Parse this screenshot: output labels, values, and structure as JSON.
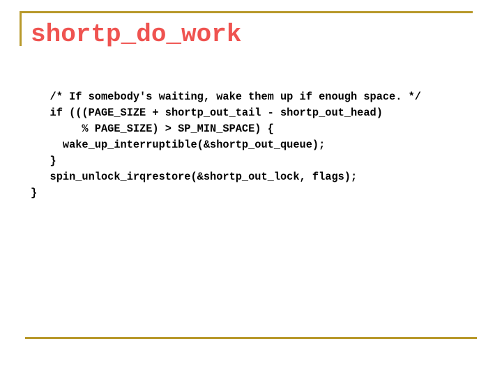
{
  "slide": {
    "title": "shortp_do_work",
    "accent_color": "#b8992b",
    "title_color": "#ef5350",
    "code_lines": [
      "   /* If somebody's waiting, wake them up if enough space. */",
      "   if (((PAGE_SIZE + shortp_out_tail - shortp_out_head)",
      "        % PAGE_SIZE) > SP_MIN_SPACE) {",
      "     wake_up_interruptible(&shortp_out_queue);",
      "   }",
      "   spin_unlock_irqrestore(&shortp_out_lock, flags);",
      "}"
    ]
  }
}
